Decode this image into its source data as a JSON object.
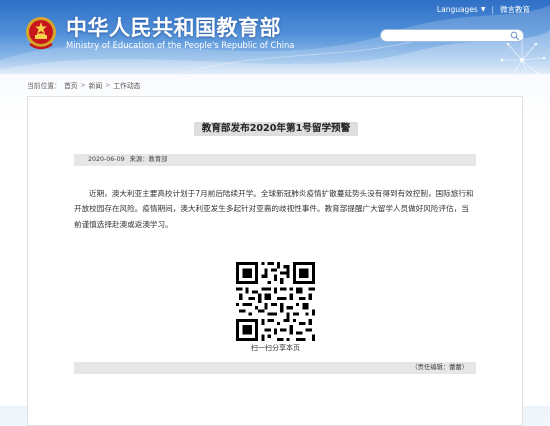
{
  "header": {
    "title_cn": "中华人民共和国教育部",
    "title_en": "Ministry of Education of the People's Republic of China",
    "languages_label": "Languages",
    "mobile_label": "微言教育",
    "search_placeholder": ""
  },
  "breadcrumb": {
    "prefix": "当前位置：",
    "items": [
      "首页",
      "新闻",
      "工作动态"
    ]
  },
  "article": {
    "title": "教育部发布2020年第1号留学预警",
    "date": "2020-06-09",
    "source": "来源：教育部",
    "body": "近期，澳大利亚主要高校计划于7月前后陆续开学。全球新冠肺炎疫情扩散蔓延势头没有得到有效控制，国际旅行和开放校园存在风险。疫情期间，澳大利亚发生多起针对亚裔的歧视性事件。教育部提醒广大留学人员做好风险评估，当前谨慎选择赴澳或返澳学习。",
    "qr_caption": "扫一扫分享本页",
    "editor": "（责任编辑：蕾蕾）"
  },
  "colors": {
    "header_top": "#2f6fc6",
    "header_bottom": "#cfe1f5",
    "bar_gray": "#e6e6e6",
    "title_bg": "#dedede"
  },
  "icons": {
    "emblem": "national-emblem-icon",
    "search": "search-icon",
    "qr": "qr-code-icon"
  }
}
